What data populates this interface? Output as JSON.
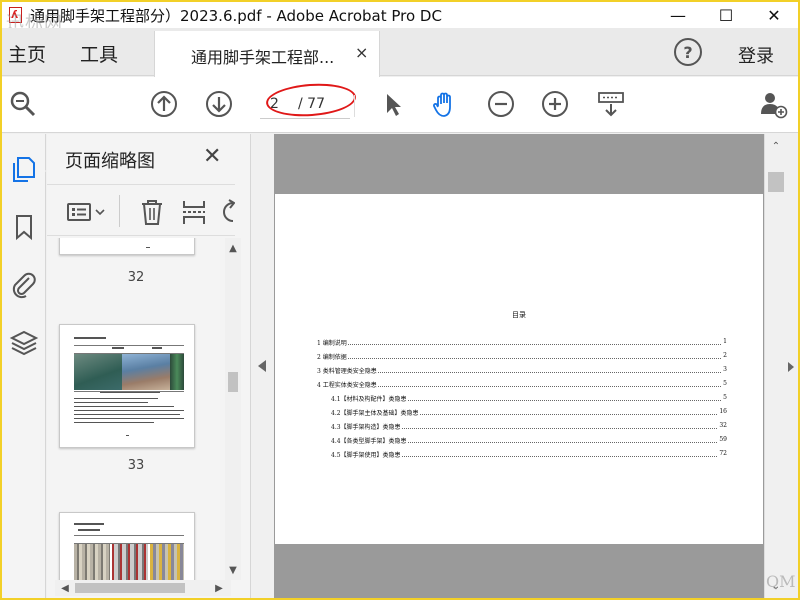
{
  "window": {
    "title": "通用脚手架工程部分）2023.6.pdf - Adobe Acrobat Pro DC",
    "watermark": "迅标网",
    "minimize_glyph": "—",
    "maximize_glyph": "☐",
    "close_glyph": "✕"
  },
  "tabs": {
    "home": "主页",
    "tools": "工具",
    "document_tab": "通用脚手架工程部...",
    "document_tab_close": "×",
    "help": "?",
    "login": "登录"
  },
  "toolbar": {
    "page_current": "2",
    "page_total": "/ 77",
    "icons": [
      "zoom-search-icon",
      "page-up-icon",
      "page-down-icon",
      "select-cursor-icon",
      "hand-tool-icon",
      "zoom-out-icon",
      "zoom-in-icon",
      "keyboard-scroll-icon",
      "share-user-icon"
    ],
    "accent_color": "#1473e6",
    "highlight_color": "#e01818"
  },
  "left_rail": {
    "icons": [
      "page-thumbnails-icon",
      "bookmark-icon",
      "attachment-icon",
      "layers-icon"
    ]
  },
  "thumbnail_panel": {
    "title": "页面缩略图",
    "close": "✕",
    "thumbs": [
      {
        "page": "32"
      },
      {
        "page": "33"
      }
    ]
  },
  "document": {
    "toc_title": "目录",
    "toc": [
      {
        "label": "1 编制说明",
        "page": "1",
        "level": 1
      },
      {
        "label": "2 编制依据",
        "page": "2",
        "level": 1
      },
      {
        "label": "3 类料管理类安全隐患",
        "page": "3",
        "level": 1
      },
      {
        "label": "4 工程实体类安全隐患",
        "page": "5",
        "level": 1
      },
      {
        "label": "4.1【材料及构配件】类隐患",
        "page": "5",
        "level": 2
      },
      {
        "label": "4.2【脚手架主体及基础】类隐患",
        "page": "16",
        "level": 2
      },
      {
        "label": "4.3【脚手架构造】类隐患",
        "page": "32",
        "level": 2
      },
      {
        "label": "4.4【各类型脚手架】类隐患",
        "page": "59",
        "level": 2
      },
      {
        "label": "4.5【脚手架使用】类隐患",
        "page": "72",
        "level": 2
      }
    ]
  },
  "corner_watermark": "QM"
}
